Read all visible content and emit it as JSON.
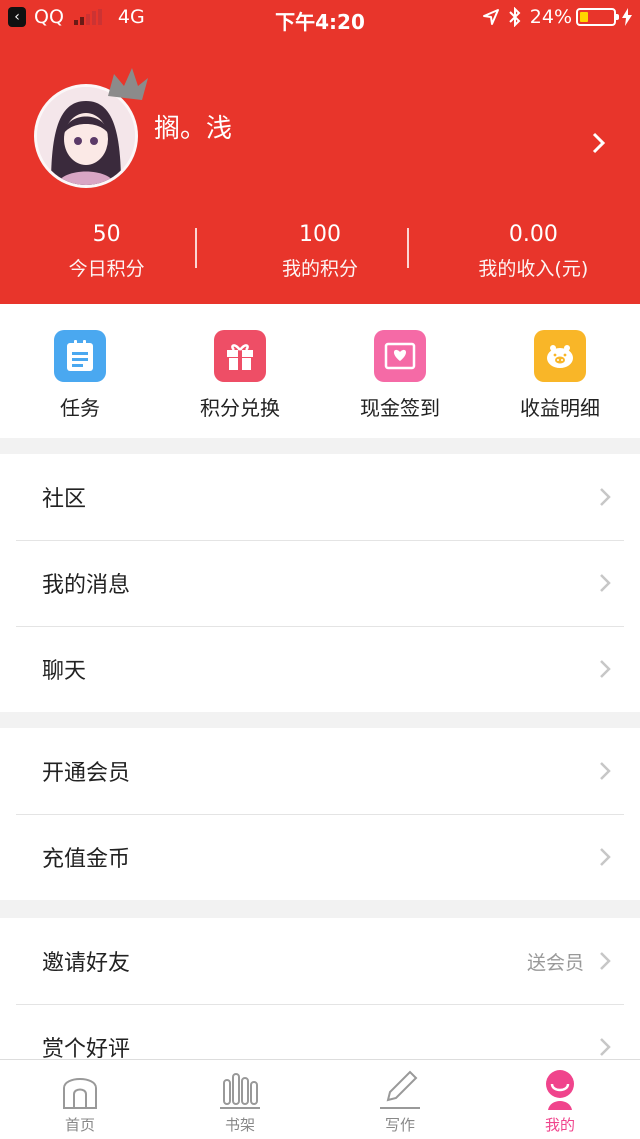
{
  "status_bar": {
    "back_app": "QQ",
    "network": "4G",
    "time": "下午4:20",
    "battery": "24%",
    "battery_level": 0.24
  },
  "profile": {
    "username": "搁。浅"
  },
  "stats": [
    {
      "value": "50",
      "label": "今日积分"
    },
    {
      "value": "100",
      "label": "我的积分"
    },
    {
      "value": "0.00",
      "label": "我的收入(元)"
    }
  ],
  "quick_actions": [
    {
      "label": "任务",
      "icon": "clipboard-icon",
      "color": "#4aa8f0"
    },
    {
      "label": "积分兑换",
      "icon": "gift-icon",
      "color": "#ee4e66"
    },
    {
      "label": "现金签到",
      "icon": "envelope-heart-icon",
      "color": "#f56aa6"
    },
    {
      "label": "收益明细",
      "icon": "piggy-bank-icon",
      "color": "#f9b628"
    }
  ],
  "groups": [
    {
      "items": [
        {
          "label": "社区"
        },
        {
          "label": "我的消息"
        },
        {
          "label": "聊天"
        }
      ]
    },
    {
      "items": [
        {
          "label": "开通会员"
        },
        {
          "label": "充值金币"
        }
      ]
    },
    {
      "items": [
        {
          "label": "邀请好友",
          "hint": "送会员"
        },
        {
          "label": "赏个好评"
        }
      ]
    }
  ],
  "tabs": [
    {
      "label": "首页",
      "icon": "home-arch-icon"
    },
    {
      "label": "书架",
      "icon": "bookshelf-icon"
    },
    {
      "label": "写作",
      "icon": "pencil-icon"
    },
    {
      "label": "我的",
      "icon": "person-icon"
    }
  ],
  "colors": {
    "header": "#e8352b",
    "tab_active": "#f0448c",
    "chevron": "#c7c7c7"
  }
}
